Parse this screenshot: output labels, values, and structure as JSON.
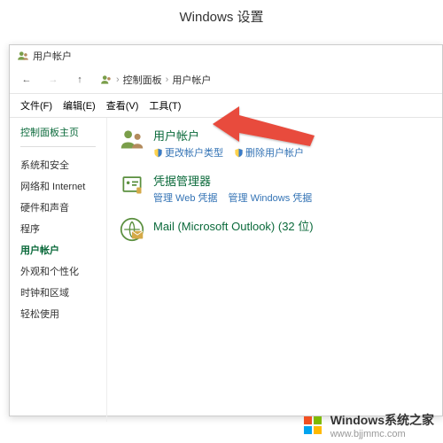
{
  "settings_title": "Windows 设置",
  "titlebar": {
    "title": "用户帐户"
  },
  "nav": {
    "back": "←",
    "forward": "→",
    "up": "↑"
  },
  "breadcrumb": {
    "item1": "控制面板",
    "item2": "用户帐户",
    "sep": "›"
  },
  "menu": {
    "file": "文件(F)",
    "edit": "编辑(E)",
    "view": "查看(V)",
    "tools": "工具(T)"
  },
  "sidebar": {
    "home": "控制面板主页",
    "items": [
      "系统和安全",
      "网络和 Internet",
      "硬件和声音",
      "程序",
      "用户帐户",
      "外观和个性化",
      "时钟和区域",
      "轻松使用"
    ]
  },
  "categories": [
    {
      "title": "用户帐户",
      "links": [
        "更改帐户类型",
        "删除用户帐户"
      ]
    },
    {
      "title": "凭据管理器",
      "links": [
        "管理 Web 凭据",
        "管理 Windows 凭据"
      ]
    },
    {
      "title": "Mail (Microsoft Outlook) (32 位)",
      "links": []
    }
  ],
  "watermark": {
    "brand": "Windows",
    "suffix": "系统之家",
    "url": "www.bjjmmc.com"
  }
}
